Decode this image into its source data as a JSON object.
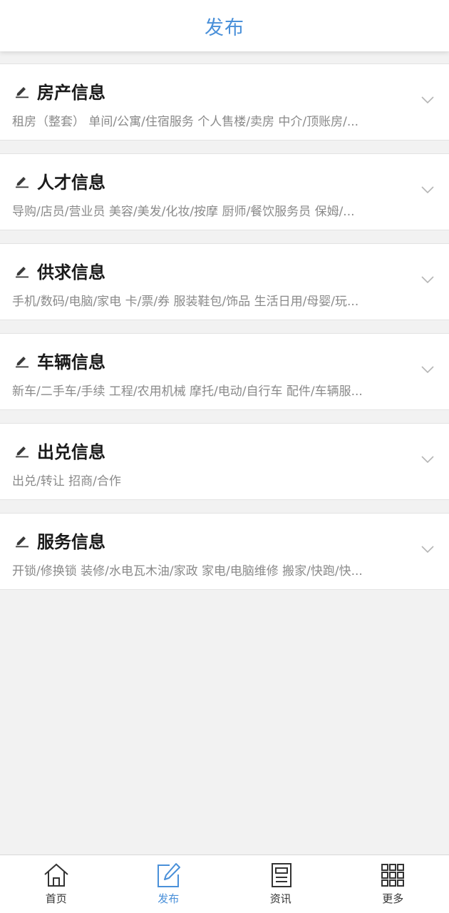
{
  "header": {
    "title": "发布"
  },
  "categories": [
    {
      "title": "房产信息",
      "subtitle": "租房（整套） 单间/公寓/住宿服务 个人售楼/卖房 中介/顶账房/..."
    },
    {
      "title": "人才信息",
      "subtitle": "导购/店员/营业员 美容/美发/化妆/按摩 厨师/餐饮服务员 保姆/..."
    },
    {
      "title": "供求信息",
      "subtitle": "手机/数码/电脑/家电 卡/票/券 服装鞋包/饰品 生活日用/母婴/玩..."
    },
    {
      "title": "车辆信息",
      "subtitle": "新车/二手车/手续 工程/农用机械 摩托/电动/自行车 配件/车辆服..."
    },
    {
      "title": "出兑信息",
      "subtitle": "出兑/转让 招商/合作"
    },
    {
      "title": "服务信息",
      "subtitle": "开锁/修换锁 装修/水电瓦木油/家政 家电/电脑维修 搬家/快跑/快..."
    }
  ],
  "tabbar": {
    "items": [
      {
        "label": "首页",
        "icon": "home-icon",
        "active": false
      },
      {
        "label": "发布",
        "icon": "edit-icon",
        "active": true
      },
      {
        "label": "资讯",
        "icon": "news-icon",
        "active": false
      },
      {
        "label": "更多",
        "icon": "grid-icon",
        "active": false
      }
    ]
  },
  "colors": {
    "accent": "#4a90d9",
    "background": "#f2f2f2",
    "card": "#ffffff",
    "title_text": "#1a1a1a",
    "subtitle_text": "#8a8a8a"
  }
}
